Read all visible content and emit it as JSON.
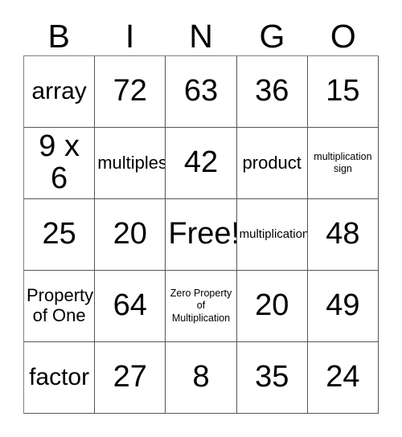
{
  "card": {
    "title_letters": [
      "B",
      "I",
      "N",
      "G",
      "O"
    ],
    "grid": {
      "rows": 5,
      "cols": 5,
      "cells": [
        [
          {
            "text": "array",
            "size": "lg"
          },
          {
            "text": "72",
            "size": "xl"
          },
          {
            "text": "63",
            "size": "xl"
          },
          {
            "text": "36",
            "size": "xl"
          },
          {
            "text": "15",
            "size": "xl"
          }
        ],
        [
          {
            "text": "9 x 6",
            "size": "xl"
          },
          {
            "text": "multiples",
            "size": "md"
          },
          {
            "text": "42",
            "size": "xl"
          },
          {
            "text": "product",
            "size": "md"
          },
          {
            "text": "multiplication sign",
            "size": "xs"
          }
        ],
        [
          {
            "text": "25",
            "size": "xl"
          },
          {
            "text": "20",
            "size": "xl"
          },
          {
            "text": "Free!",
            "size": "xl"
          },
          {
            "text": "multiplication",
            "size": "sm"
          },
          {
            "text": "48",
            "size": "xl"
          }
        ],
        [
          {
            "text": "Property of One",
            "size": "md"
          },
          {
            "text": "64",
            "size": "xl"
          },
          {
            "text": "Zero Property of Multiplication",
            "size": "xs"
          },
          {
            "text": "20",
            "size": "xl"
          },
          {
            "text": "49",
            "size": "xl"
          }
        ],
        [
          {
            "text": "factor",
            "size": "lg"
          },
          {
            "text": "27",
            "size": "xl"
          },
          {
            "text": "8",
            "size": "xl"
          },
          {
            "text": "35",
            "size": "xl"
          },
          {
            "text": "24",
            "size": "xl"
          }
        ]
      ]
    },
    "colors": {
      "background": "#ffffff",
      "text": "#000000",
      "grid_line": "#555555",
      "outer_line": "#808080"
    }
  }
}
